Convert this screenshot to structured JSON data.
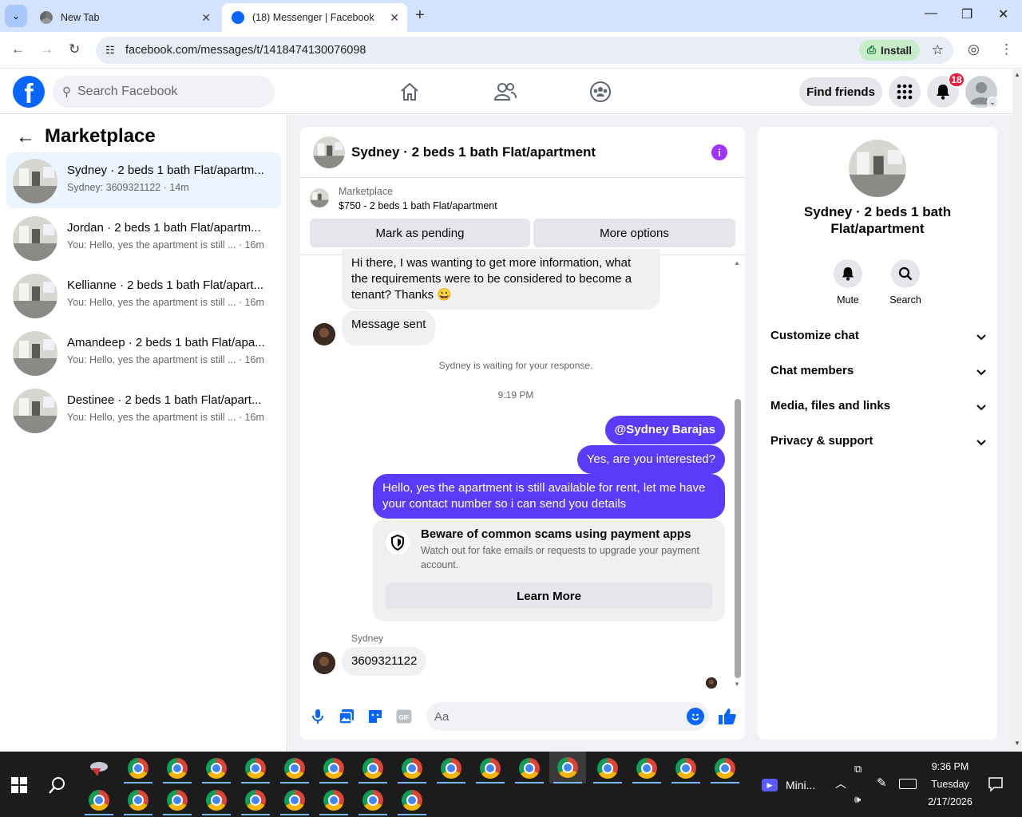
{
  "browser": {
    "tabs": [
      {
        "title": "New Tab"
      },
      {
        "title": "(18) Messenger | Facebook"
      }
    ],
    "url": "facebook.com/messages/t/1418474130076098",
    "install_label": "Install"
  },
  "fb_header": {
    "search_placeholder": "Search Facebook",
    "find_friends_label": "Find friends",
    "notification_count": "18"
  },
  "left_panel": {
    "title": "Marketplace",
    "conversations": [
      {
        "title": "Sydney · 2 beds 1 bath Flat/apartm...",
        "subtitle": "Sydney: 3609321122 · 14m",
        "active": true
      },
      {
        "title": "Jordan · 2 beds 1 bath Flat/apartm...",
        "subtitle": "You: Hello, yes the apartment is still ... · 16m",
        "active": false
      },
      {
        "title": "Kellianne · 2 beds 1 bath Flat/apart...",
        "subtitle": "You: Hello, yes the apartment is still ... · 16m",
        "active": false
      },
      {
        "title": "Amandeep · 2 beds 1 bath Flat/apa...",
        "subtitle": "You: Hello, yes the apartment is still ... · 16m",
        "active": false
      },
      {
        "title": "Destinee · 2 beds 1 bath Flat/apart...",
        "subtitle": "You: Hello, yes the apartment is still ... · 16m",
        "active": false
      }
    ]
  },
  "chat": {
    "header_title": "Sydney · 2 beds 1 bath Flat/apartment",
    "marketplace_label": "Marketplace",
    "listing": "$750 - 2 beds 1 bath Flat/apartment",
    "mark_pending_label": "Mark as pending",
    "more_options_label": "More options",
    "messages": {
      "incoming_1": "Hi there, I was wanting to get more information, what the requirements were to be considered to become a tenant? Thanks 😀",
      "incoming_2": "Message sent",
      "waiting_notice": "Sydney is waiting for your response.",
      "timestamp": "9:19 PM",
      "outgoing_1": "@Sydney Barajas",
      "outgoing_2": "Yes, are you interested?",
      "outgoing_3": "Hello, yes the apartment is still available for rent, let me have your contact number so i can send you details",
      "sender_name": "Sydney",
      "incoming_3": "3609321122"
    },
    "scam_card": {
      "heading": "Beware of common scams using payment apps",
      "body": "Watch out for fake emails or requests to upgrade your payment account.",
      "button_label": "Learn More"
    },
    "composer_placeholder": "Aa"
  },
  "right_panel": {
    "name": "Sydney · 2 beds 1 bath Flat/apartment",
    "actions": [
      {
        "label": "Mute",
        "icon": "bell-icon"
      },
      {
        "label": "Search",
        "icon": "search-icon"
      }
    ],
    "sections": [
      {
        "label": "Customize chat"
      },
      {
        "label": "Chat members"
      },
      {
        "label": "Media, files and links"
      },
      {
        "label": "Privacy & support"
      }
    ]
  },
  "taskbar": {
    "mini_label": "Mini...",
    "time": "9:36 PM",
    "day": "Tuesday",
    "date": "2/17/2026"
  },
  "colors": {
    "facebook_blue": "#0866ff",
    "outgoing_bubble": "#5b3bfa",
    "active_conversation": "#ebf5ff",
    "notification_badge": "#e41e3f"
  }
}
